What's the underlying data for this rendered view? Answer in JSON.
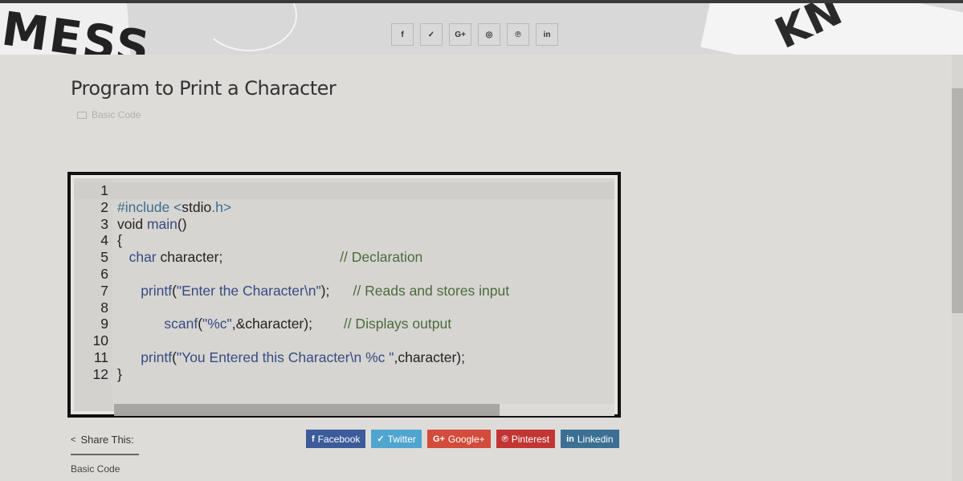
{
  "header": {
    "social_icons": [
      {
        "icon": "facebook-icon",
        "glyph": "f"
      },
      {
        "icon": "twitter-icon",
        "glyph": "✓"
      },
      {
        "icon": "google-plus-icon",
        "glyph": "G+"
      },
      {
        "icon": "instagram-icon",
        "glyph": "◎"
      },
      {
        "icon": "pinterest-icon",
        "glyph": "℗"
      },
      {
        "icon": "linkedin-icon",
        "glyph": "in"
      }
    ]
  },
  "post": {
    "title": "Program to Print a Character",
    "category": "Basic Code"
  },
  "code": {
    "lines": [
      {
        "num": "1",
        "parts": []
      },
      {
        "num": "2",
        "parts": [
          {
            "t": "#include <",
            "c": "k1"
          },
          {
            "t": "stdio",
            "c": ""
          },
          {
            "t": ".h>",
            "c": "k1"
          }
        ]
      },
      {
        "num": "3",
        "parts": [
          {
            "t": "void ",
            "c": ""
          },
          {
            "t": "main",
            "c": "kf"
          },
          {
            "t": "()",
            "c": ""
          }
        ]
      },
      {
        "num": "4",
        "parts": [
          {
            "t": "{",
            "c": ""
          }
        ]
      },
      {
        "num": "5",
        "parts": [
          {
            "t": "   ",
            "c": ""
          },
          {
            "t": "char",
            "c": "kf"
          },
          {
            "t": " character;                              ",
            "c": ""
          },
          {
            "t": "// Declaration",
            "c": "cm"
          }
        ]
      },
      {
        "num": "6",
        "parts": []
      },
      {
        "num": "7",
        "parts": [
          {
            "t": "      ",
            "c": ""
          },
          {
            "t": "printf",
            "c": "kf"
          },
          {
            "t": "(",
            "c": ""
          },
          {
            "t": "\"Enter the Character\\n\"",
            "c": "kf"
          },
          {
            "t": ");      ",
            "c": ""
          },
          {
            "t": "// Reads and stores input",
            "c": "cm"
          }
        ]
      },
      {
        "num": "8",
        "parts": []
      },
      {
        "num": "9",
        "parts": [
          {
            "t": "            ",
            "c": ""
          },
          {
            "t": "scanf",
            "c": "kf"
          },
          {
            "t": "(",
            "c": ""
          },
          {
            "t": "\"%c\"",
            "c": "kf"
          },
          {
            "t": ",&character);        ",
            "c": ""
          },
          {
            "t": "// Displays output",
            "c": "cm"
          }
        ]
      },
      {
        "num": "10",
        "parts": []
      },
      {
        "num": "11",
        "parts": [
          {
            "t": "      ",
            "c": ""
          },
          {
            "t": "printf",
            "c": "kf"
          },
          {
            "t": "(",
            "c": ""
          },
          {
            "t": "\"You Entered this Character\\n %c \"",
            "c": "kf"
          },
          {
            "t": ",character);",
            "c": ""
          }
        ]
      },
      {
        "num": "12",
        "parts": [
          {
            "t": "}",
            "c": ""
          }
        ]
      }
    ]
  },
  "share": {
    "label": "Share This:",
    "buttons": [
      {
        "label": "Facebook",
        "glyph": "f",
        "cls": "fb",
        "icon": "facebook-icon"
      },
      {
        "label": "Twitter",
        "glyph": "✓",
        "cls": "tw",
        "icon": "twitter-icon"
      },
      {
        "label": "Google+",
        "glyph": "G+",
        "cls": "gp",
        "icon": "google-plus-icon"
      },
      {
        "label": "Pinterest",
        "glyph": "℗",
        "cls": "pi",
        "icon": "pinterest-icon"
      },
      {
        "label": "Linkedin",
        "glyph": "in",
        "cls": "li",
        "icon": "linkedin-icon"
      }
    ]
  },
  "footer": {
    "tag": "Basic Code"
  }
}
